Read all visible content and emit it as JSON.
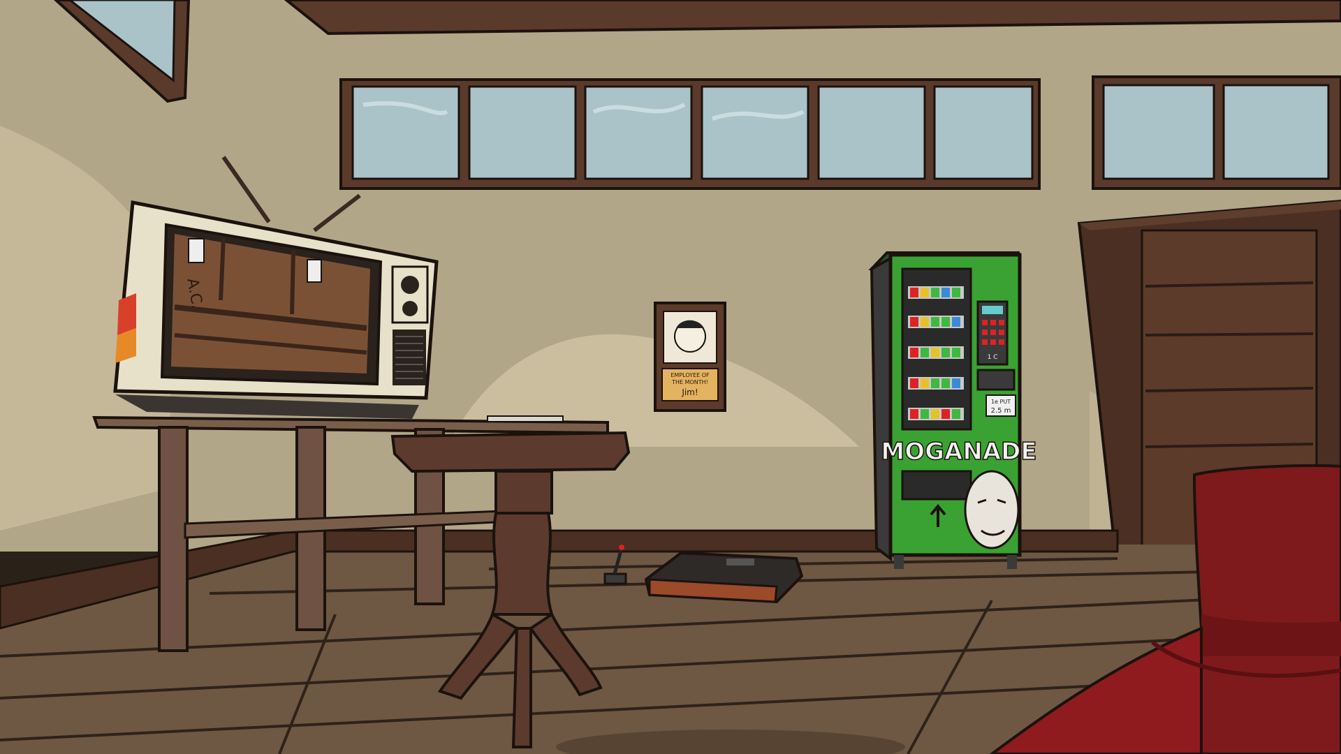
{
  "scene": {
    "description_hidden": "",
    "vending_machine": {
      "brand": "MOGANADE",
      "price_tag_line1": "1e PUT",
      "price_tag_line2": "2.5 m",
      "keypad_label": "1 C"
    },
    "poster": {
      "caption_line1": "EMPLOYEE OF",
      "caption_line2": "THE MONTH!",
      "name": "Jim!"
    },
    "tv": {
      "sticker_text": "A.C."
    },
    "colors": {
      "wall": "#b5a98a",
      "floor": "#6e5843",
      "wood_dark": "#4a2f22",
      "vending_green": "#3aa232",
      "couch_red": "#8f1b1e",
      "window_glass": "#a9c3c9"
    }
  }
}
